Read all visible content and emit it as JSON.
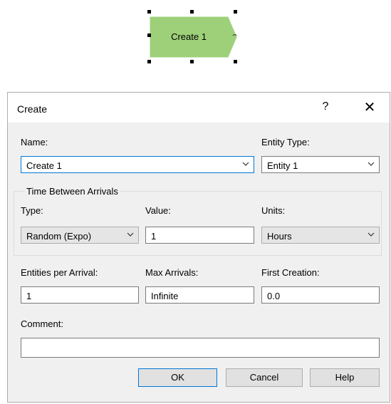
{
  "canvas": {
    "module": {
      "label": "Create 1",
      "fill_color": "#9ed07a",
      "icon": "create-module-shape"
    }
  },
  "dialog": {
    "title": "Create",
    "help_label": "?",
    "close_label": "✕",
    "name": {
      "label": "Name:",
      "value": "Create 1"
    },
    "entity_type": {
      "label": "Entity Type:",
      "value": "Entity 1"
    },
    "time_between_arrivals": {
      "group_label": "Time Between Arrivals",
      "type": {
        "label": "Type:",
        "value": "Random (Expo)"
      },
      "value": {
        "label": "Value:",
        "value": "1"
      },
      "units": {
        "label": "Units:",
        "value": "Hours"
      }
    },
    "entities_per_arrival": {
      "label": "Entities per Arrival:",
      "value": "1"
    },
    "max_arrivals": {
      "label": "Max Arrivals:",
      "value": "Infinite"
    },
    "first_creation": {
      "label": "First Creation:",
      "value": "0.0"
    },
    "comment": {
      "label": "Comment:",
      "value": ""
    },
    "buttons": {
      "ok": "OK",
      "cancel": "Cancel",
      "help": "Help"
    },
    "accent_color": "#0078d7"
  }
}
